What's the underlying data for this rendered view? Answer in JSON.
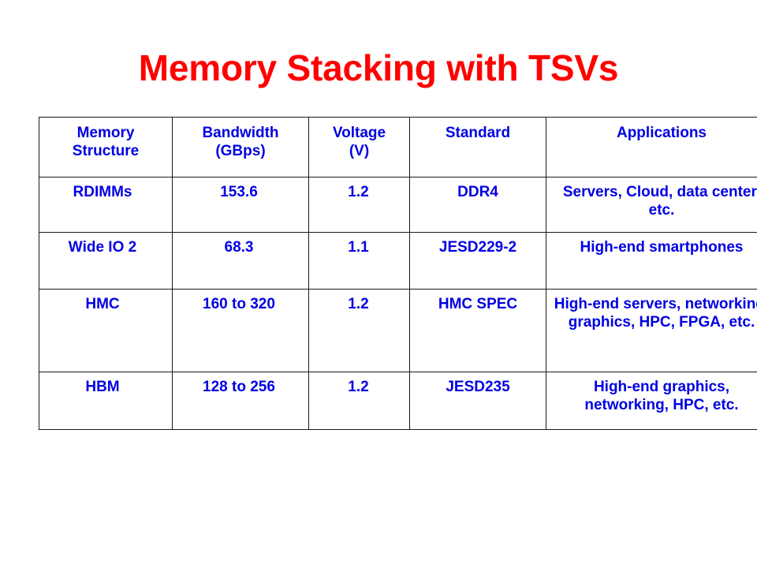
{
  "slide": {
    "title": "Memory Stacking with TSVs",
    "title_color": "#ff0000",
    "text_color": "#0000e2",
    "background_color": "#ffffff",
    "border_color": "#1a1a1a"
  },
  "table": {
    "columns": [
      "Memory Structure",
      "Bandwidth (GBps)",
      "Voltage (V)",
      "Standard",
      "Applications"
    ],
    "headers": {
      "memory_structure_line1": "Memory",
      "memory_structure_line2": "Structure",
      "bandwidth_line1": "Bandwidth",
      "bandwidth_line2": "(GBps)",
      "voltage_line1": "Voltage",
      "voltage_line2": "(V)",
      "standard": "Standard",
      "applications": "Applications"
    },
    "rows": [
      {
        "memory_structure": "RDIMMs",
        "bandwidth": "153.6",
        "voltage": "1.2",
        "standard": "DDR4",
        "applications": "Servers, Cloud, data center, etc."
      },
      {
        "memory_structure": "Wide IO 2",
        "bandwidth": "68.3",
        "voltage": "1.1",
        "standard": "JESD229-2",
        "applications": "High-end smartphones"
      },
      {
        "memory_structure": "HMC",
        "bandwidth": "160 to 320",
        "voltage": "1.2",
        "standard": "HMC SPEC",
        "applications": "High-end servers, networking, graphics, HPC, FPGA, etc."
      },
      {
        "memory_structure": "HBM",
        "bandwidth": "128 to 256",
        "voltage": "1.2",
        "standard": "JESD235",
        "applications": "High-end graphics, networking, HPC, etc."
      }
    ]
  }
}
